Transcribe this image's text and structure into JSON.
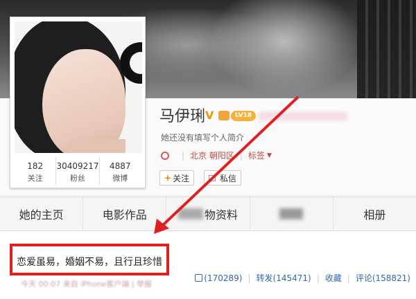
{
  "profile": {
    "name": "马伊琍",
    "verified_badge": "V",
    "level_badge": "LV18",
    "intro": "她还没有填写个人简介",
    "location": "北京 朝阳区",
    "tags_label": "标签",
    "follow_button": "关注",
    "message_button": "私信"
  },
  "stats": [
    {
      "value": "182",
      "label": "关注"
    },
    {
      "value": "30409217",
      "label": "粉丝"
    },
    {
      "value": "4887",
      "label": "微博"
    }
  ],
  "nav": {
    "tabs": [
      "她的主页",
      "电影作品",
      "物资料",
      "相册"
    ]
  },
  "post": {
    "text": "恋爱虽易，婚姻不易，且行且珍惜",
    "likes": "(170289)",
    "repost": "转发(145471)",
    "favorite": "收藏",
    "comments": "评论(158821)"
  },
  "colors": {
    "annotation_red": "#e02020",
    "link_blue": "#3366aa"
  }
}
